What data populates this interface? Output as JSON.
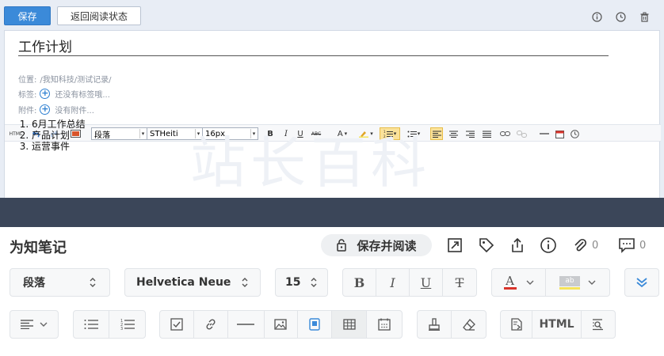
{
  "old_editor": {
    "buttons": {
      "save": "保存",
      "back": "返回阅读状态"
    },
    "title": "工作计划",
    "meta": {
      "location_label": "位置:",
      "location_value": "/我知科技/测试记录/",
      "tags_label": "标签:",
      "tags_value": "还没有标签哦...",
      "attach_label": "附件:",
      "attach_value": "没有附件..."
    },
    "toolbar": {
      "html": "HTML",
      "paragraph": "段落",
      "font": "STHeiti",
      "size": "16px",
      "bold": "B",
      "italic": "I",
      "underline": "U",
      "strike": "ABC",
      "fontcolor": "A"
    },
    "content": [
      "6月工作总结",
      "产品计划",
      "运营事件"
    ],
    "watermark": "站长百科"
  },
  "new_editor": {
    "app_title": "为知笔记",
    "save_read": "保存并阅读",
    "attach_count": "0",
    "comment_count": "0",
    "paragraph": "段落",
    "font": "Helvetica Neue",
    "size": "15",
    "bold": "B",
    "italic": "I",
    "underline": "U",
    "strike": "T",
    "fontcolor": "A",
    "highlight": "ab",
    "html": "HTML"
  },
  "colors": {
    "accent": "#3b8ad9",
    "divider": "#3b4659",
    "font_color_red": "#d9342b",
    "highlight_yellow": "#f5e35a"
  }
}
